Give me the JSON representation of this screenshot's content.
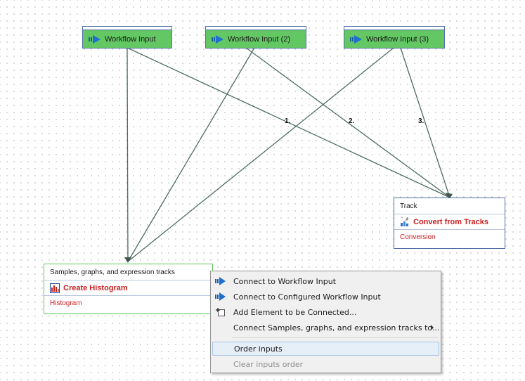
{
  "workflow_inputs": [
    {
      "label": "Workflow Input"
    },
    {
      "label": "Workflow Input (2)"
    },
    {
      "label": "Workflow Input (3)"
    }
  ],
  "order_labels": [
    "1.",
    "2.",
    "3."
  ],
  "convert_node": {
    "port": "Track",
    "title": "Convert from Tracks",
    "subtitle": "Conversion"
  },
  "histogram_node": {
    "port": "Samples, graphs, and expression tracks",
    "title": "Create Histogram",
    "subtitle": "Histogram"
  },
  "context_menu": {
    "items": [
      {
        "label": "Connect to Workflow Input",
        "icon": "workflow-input-arrow-icon"
      },
      {
        "label": "Connect to Configured Workflow Input",
        "icon": "workflow-input-arrow-icon"
      },
      {
        "label": "Add Element to be Connected...",
        "icon": "add-element-icon"
      },
      {
        "label": "Connect Samples, graphs, and expression tracks to...",
        "icon": ""
      }
    ],
    "order_inputs": "Order inputs",
    "clear_order": "Clear inputs order"
  },
  "colors": {
    "input_fill": "#63c763",
    "node_border": "#4f6fa8",
    "tool_title": "#cc1f1f",
    "wire": "#4d6b5e"
  }
}
